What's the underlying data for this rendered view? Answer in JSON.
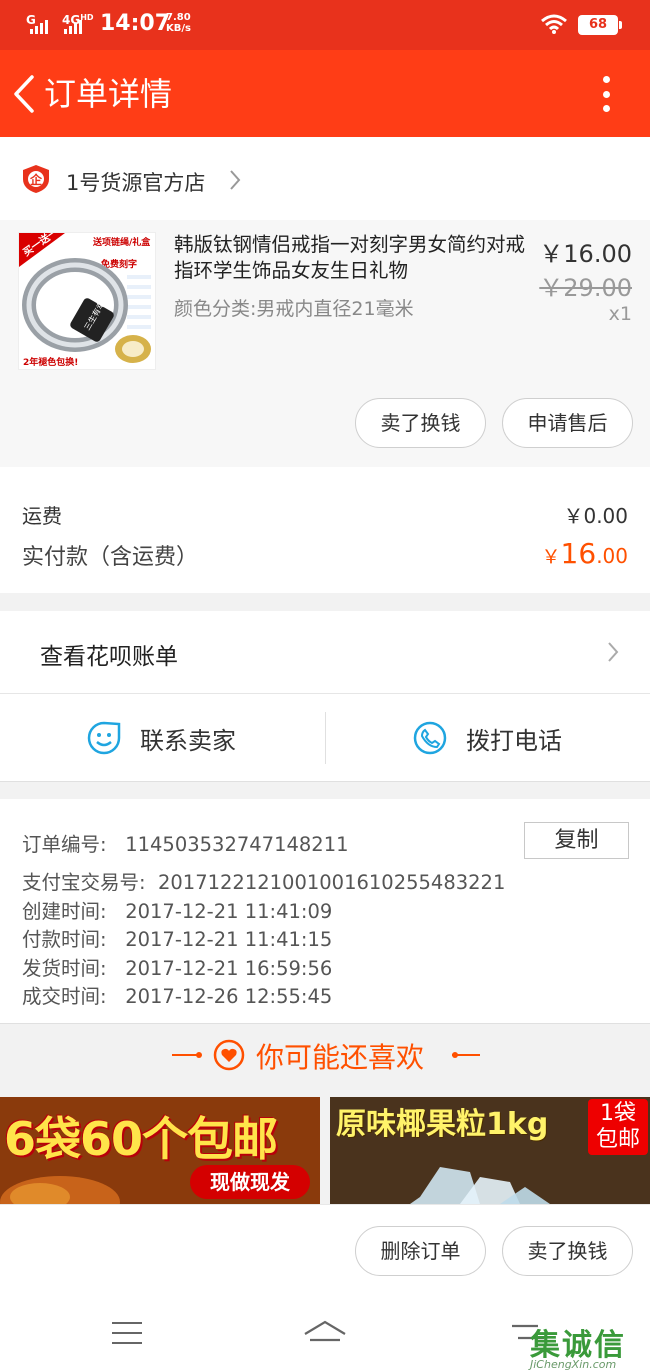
{
  "status_bar": {
    "signal1": "G",
    "signal2": "4G",
    "signal2_sup": "HD",
    "time": "14:07",
    "speed_value": "7.80",
    "speed_unit": "KB/s",
    "battery": "68"
  },
  "header": {
    "title": "订单详情",
    "back_icon": "chevron-left-icon",
    "more_icon": "more-vertical-icon"
  },
  "shop": {
    "name": "1号货源官方店",
    "badge_text": "企",
    "badge_color": "#e8321c"
  },
  "product": {
    "title": "韩版钛钢情侣戒指一对刻字男女简约对戒指环学生饰品女友生日礼物",
    "spec": "颜色分类:男戒内直径21毫米",
    "price": "￥16.00",
    "original_price": "￥29.00",
    "quantity": "x1",
    "image_labels": {
      "corner": "买一送一",
      "top": "送项链绳/礼盒",
      "engrave": "免费刻字",
      "bottom": "2年褪色包换!",
      "ring_text": "三生有幸"
    },
    "actions": {
      "sell": "卖了换钱",
      "after_sale": "申请售后"
    }
  },
  "fees": {
    "shipping_label": "运费",
    "shipping_value": "￥0.00",
    "paid_label": "实付款（含运费）",
    "paid_currency": "￥",
    "paid_int": "16",
    "paid_dec": ".00",
    "accent": "#ff5000"
  },
  "huabei": {
    "label": "查看花呗账单"
  },
  "contact": {
    "seller": "联系卖家",
    "call": "拨打电话",
    "icon_color": "#1fa5e0"
  },
  "order_info": {
    "copy_label": "复制",
    "lines": [
      {
        "key": "订单编号:",
        "value": "114503532747148211"
      },
      {
        "key": "支付宝交易号:",
        "value": "2017122121001001610255483221"
      },
      {
        "key": "创建时间:",
        "value": "2017-12-21 11:41:09"
      },
      {
        "key": "付款时间:",
        "value": "2017-12-21 11:41:15"
      },
      {
        "key": "发货时间:",
        "value": "2017-12-21 16:59:56"
      },
      {
        "key": "成交时间:",
        "value": "2017-12-26 12:55:45"
      }
    ]
  },
  "recommend": {
    "title": "你可能还喜欢",
    "left_banner": "6袋60个包邮",
    "left_banner_sub": "现做现发",
    "right_banner": "原味椰果粒1kg",
    "right_badge_line1": "1袋",
    "right_badge_line2": "包邮"
  },
  "bottom_actions": {
    "delete": "删除订单",
    "sell": "卖了换钱"
  },
  "watermark": {
    "text": "集诚信",
    "sub": "JiChengXin.com"
  }
}
